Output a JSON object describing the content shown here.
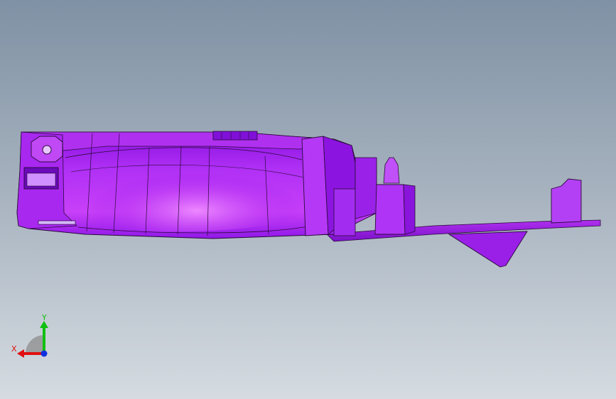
{
  "viewport": {
    "background_top": "#7f91a4",
    "background_bottom": "#d5dbe1"
  },
  "model": {
    "icon": "3d-part-model",
    "fill_color": "#a020f0",
    "highlight_color": "#e070ff",
    "edge_color": "#2a0a3a"
  },
  "triad": {
    "x_label": "X",
    "y_label": "Y",
    "x_color": "#e01010",
    "y_color": "#10c010",
    "z_color": "#1030e0"
  }
}
